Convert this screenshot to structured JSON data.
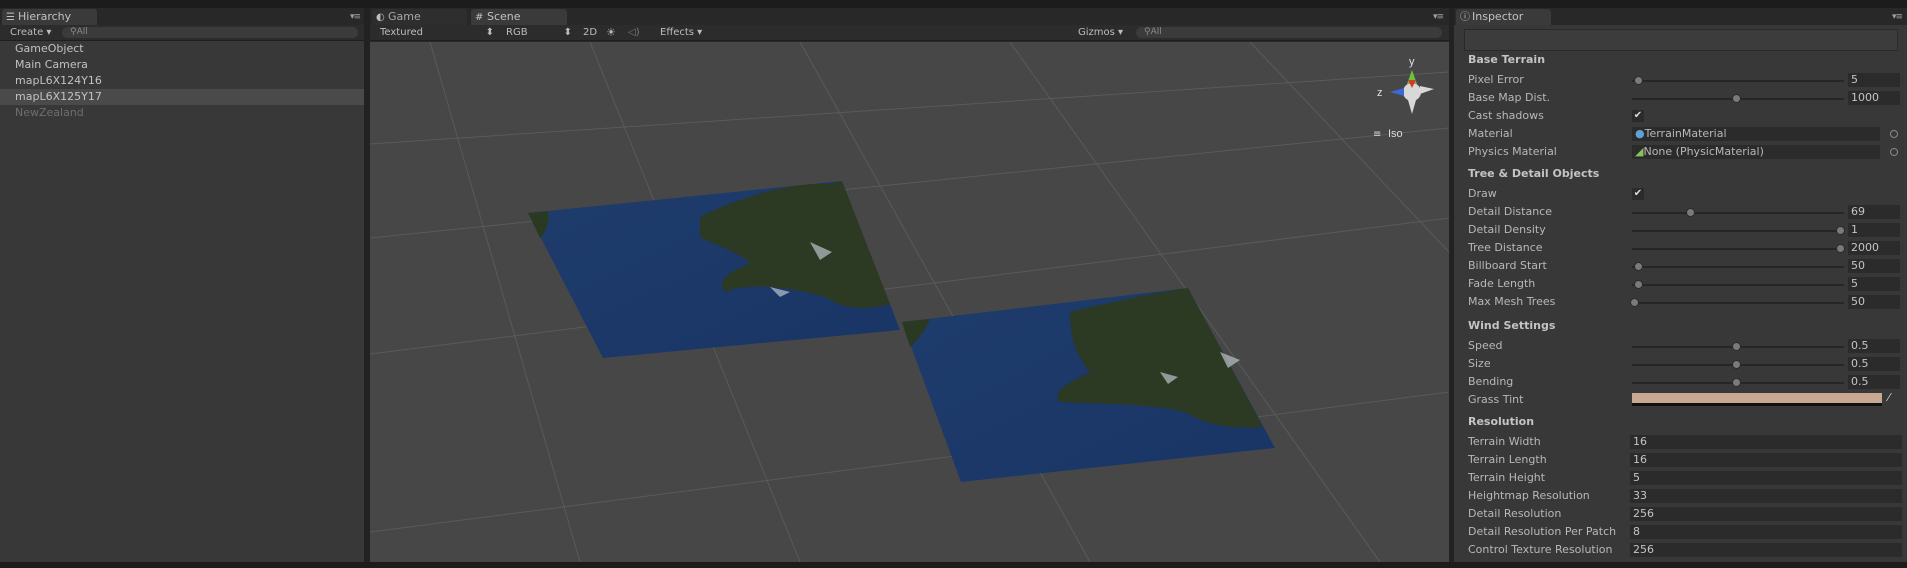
{
  "hierarchy": {
    "tab_label": "Hierarchy",
    "create_label": "Create",
    "search_placeholder": "All",
    "items": [
      "GameObject",
      "Main Camera",
      "mapL6X124Y16",
      "mapL6X125Y17",
      "NewZealand"
    ]
  },
  "view": {
    "game_tab": "Game",
    "scene_tab": "Scene",
    "draw_mode": "Textured",
    "render_mode": "RGB",
    "mode_2d": "2D",
    "effects_label": "Effects",
    "gizmos_label": "Gizmos",
    "search_placeholder": "All",
    "gizmo_y": "y",
    "gizmo_z": "z",
    "projection_label": "Iso"
  },
  "inspector": {
    "tab_label": "Inspector",
    "base_terrain": {
      "header": "Base Terrain",
      "pixel_error_label": "Pixel Error",
      "pixel_error": "5",
      "base_map_label": "Base Map Dist.",
      "base_map": "1000",
      "cast_shadows_label": "Cast shadows",
      "material_label": "Material",
      "material": "TerrainMaterial",
      "physics_label": "Physics Material",
      "physics": "None (PhysicMaterial)"
    },
    "tree_detail": {
      "header": "Tree & Detail Objects",
      "draw_label": "Draw",
      "detail_distance_label": "Detail Distance",
      "detail_distance": "69",
      "detail_density_label": "Detail Density",
      "detail_density": "1",
      "tree_distance_label": "Tree Distance",
      "tree_distance": "2000",
      "billboard_label": "Billboard Start",
      "billboard": "50",
      "fade_label": "Fade Length",
      "fade": "5",
      "max_mesh_label": "Max Mesh Trees",
      "max_mesh": "50"
    },
    "wind": {
      "header": "Wind Settings",
      "speed_label": "Speed",
      "speed": "0.5",
      "size_label": "Size",
      "size": "0.5",
      "bending_label": "Bending",
      "bending": "0.5",
      "grass_tint_label": "Grass Tint",
      "grass_tint_color": "#c8a890"
    },
    "resolution": {
      "header": "Resolution",
      "width_label": "Terrain Width",
      "width": "16",
      "length_label": "Terrain Length",
      "length": "16",
      "height_label": "Terrain Height",
      "height": "5",
      "heightmap_label": "Heightmap Resolution",
      "heightmap": "33",
      "detail_res_label": "Detail Resolution",
      "detail_res": "256",
      "detail_patch_label": "Detail Resolution Per Patch",
      "detail_patch": "8",
      "control_label": "Control Texture Resolution",
      "control": "256"
    }
  }
}
